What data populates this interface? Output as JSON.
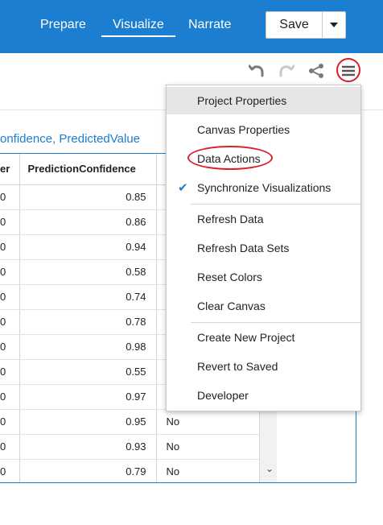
{
  "nav": {
    "tabs": [
      "Prepare",
      "Visualize",
      "Narrate"
    ],
    "save_label": "Save"
  },
  "toolbar": {
    "icons": [
      "undo-icon",
      "redo-icon",
      "share-icon",
      "hamburger-menu-icon"
    ]
  },
  "visualization": {
    "title": "onfidence, PredictedValue",
    "columns": [
      "er",
      "PredictionConfidence",
      ""
    ],
    "rows": [
      {
        "a": "0",
        "confidence": "0.85",
        "value": ""
      },
      {
        "a": "0",
        "confidence": "0.86",
        "value": ""
      },
      {
        "a": "0",
        "confidence": "0.94",
        "value": ""
      },
      {
        "a": "0",
        "confidence": "0.58",
        "value": ""
      },
      {
        "a": "0",
        "confidence": "0.74",
        "value": ""
      },
      {
        "a": "0",
        "confidence": "0.78",
        "value": ""
      },
      {
        "a": "0",
        "confidence": "0.98",
        "value": ""
      },
      {
        "a": "0",
        "confidence": "0.55",
        "value": ""
      },
      {
        "a": "0",
        "confidence": "0.97",
        "value": ""
      },
      {
        "a": "0",
        "confidence": "0.95",
        "value": "No"
      },
      {
        "a": "0",
        "confidence": "0.93",
        "value": "No"
      },
      {
        "a": "0",
        "confidence": "0.79",
        "value": "No"
      }
    ]
  },
  "menu": {
    "items": [
      {
        "label": "Project Properties"
      },
      {
        "label": "Canvas Properties"
      },
      {
        "label": "Data Actions"
      },
      {
        "label": "Synchronize Visualizations",
        "checked": true
      },
      {
        "label": "Refresh Data"
      },
      {
        "label": "Refresh Data Sets"
      },
      {
        "label": "Reset Colors"
      },
      {
        "label": "Clear Canvas"
      },
      {
        "label": "Create New Project"
      },
      {
        "label": "Revert to Saved"
      },
      {
        "label": "Developer"
      }
    ]
  },
  "colors": {
    "brand": "#1b7ed0",
    "annotation": "#d9202a"
  }
}
